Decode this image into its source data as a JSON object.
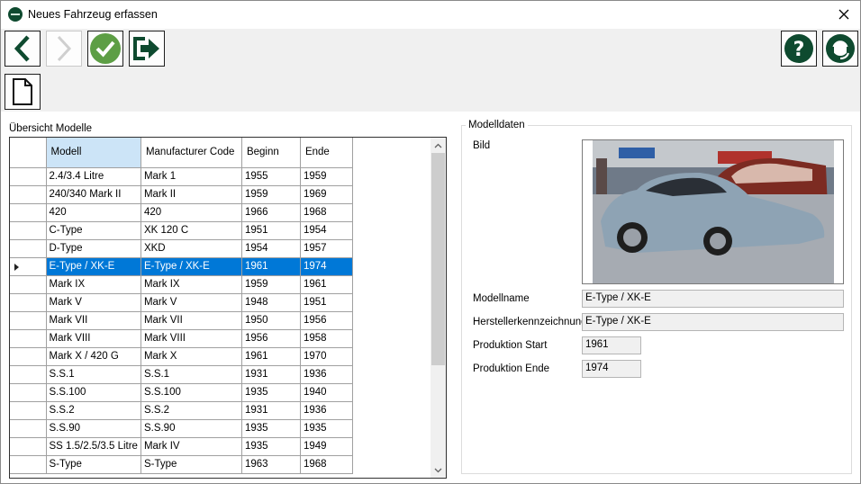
{
  "window": {
    "title": "Neues Fahrzeug erfassen"
  },
  "toolbar": {
    "back": "back-arrow-icon",
    "forward": "forward-arrow-icon",
    "confirm": "checkmark-icon",
    "exit": "exit-icon",
    "new_document": "new-document-icon",
    "help": "help-icon",
    "support": "support-headset-icon"
  },
  "colors": {
    "accent": "#0e4a2f",
    "selection": "#0078d7",
    "sorted_header": "#cce4f7"
  },
  "grid": {
    "label": "Übersicht Modelle",
    "columns": [
      "Modell",
      "Manufacturer Code",
      "Beginn",
      "Ende"
    ],
    "selected_index": 5,
    "rows": [
      [
        "2.4/3.4 Litre",
        "Mark 1",
        "1955",
        "1959"
      ],
      [
        "240/340 Mark II",
        "Mark II",
        "1959",
        "1969"
      ],
      [
        "420",
        "420",
        "1966",
        "1968"
      ],
      [
        "C-Type",
        "XK 120 C",
        "1951",
        "1954"
      ],
      [
        "D-Type",
        "XKD",
        "1954",
        "1957"
      ],
      [
        "E-Type / XK-E",
        "E-Type / XK-E",
        "1961",
        "1974"
      ],
      [
        "Mark IX",
        "Mark IX",
        "1959",
        "1961"
      ],
      [
        "Mark V",
        "Mark V",
        "1948",
        "1951"
      ],
      [
        "Mark VII",
        "Mark VII",
        "1950",
        "1956"
      ],
      [
        "Mark VIII",
        "Mark VIII",
        "1956",
        "1958"
      ],
      [
        "Mark X / 420 G",
        "Mark X",
        "1961",
        "1970"
      ],
      [
        "S.S.1",
        "S.S.1",
        "1931",
        "1936"
      ],
      [
        "S.S.100",
        "S.S.100",
        "1935",
        "1940"
      ],
      [
        "S.S.2",
        "S.S.2",
        "1931",
        "1936"
      ],
      [
        "S.S.90",
        "S.S.90",
        "1935",
        "1935"
      ],
      [
        "SS 1.5/2.5/3.5 Litre",
        "Mark IV",
        "1935",
        "1949"
      ],
      [
        "S-Type",
        "S-Type",
        "1963",
        "1968"
      ]
    ]
  },
  "details": {
    "group_title": "Modelldaten",
    "bild_label": "Bild",
    "modellname_label": "Modellname",
    "modellname_value": "E-Type / XK-E",
    "hersteller_label": "Herstellerkennzeichnung",
    "hersteller_value": "E-Type / XK-E",
    "start_label": "Produktion Start",
    "start_value": "1961",
    "ende_label": "Produktion Ende",
    "ende_value": "1974"
  }
}
